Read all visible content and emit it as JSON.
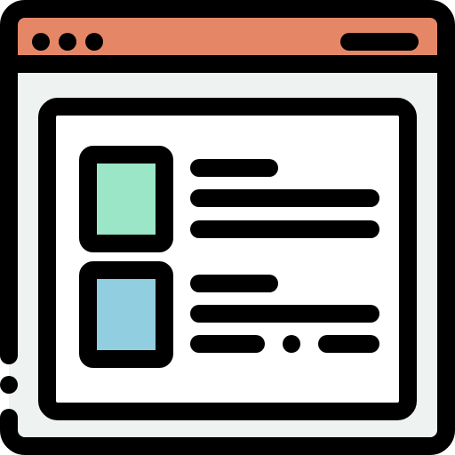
{
  "icon": {
    "name": "browser-window-list-icon",
    "colors": {
      "outline": "#000000",
      "title_bar": "#E58766",
      "window_body": "#EEF2F1",
      "content_panel": "#FFFFFF",
      "thumbnail_1": "#9AE6C6",
      "thumbnail_2": "#90CEE0"
    },
    "title_bar": {
      "dots": 3,
      "has_menu_pill": true
    },
    "list_items": [
      {
        "thumbnail": "green",
        "text_lines": 3,
        "last_line_style": "solid"
      },
      {
        "thumbnail": "blue",
        "text_lines": 3,
        "last_line_style": "dashed-with-dot"
      }
    ]
  }
}
